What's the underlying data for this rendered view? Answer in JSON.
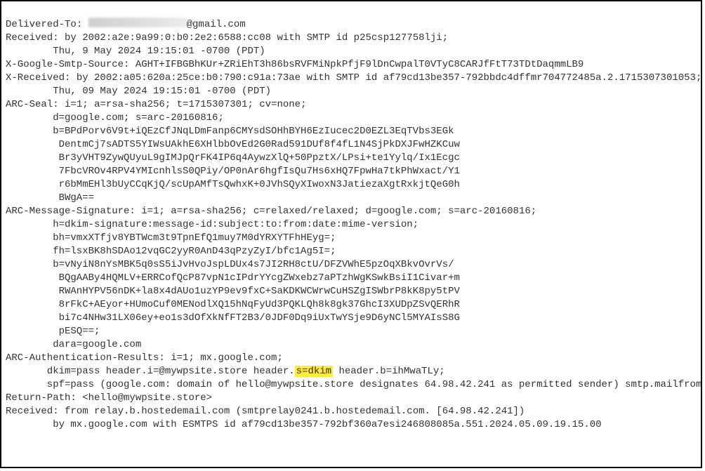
{
  "lines": {
    "l01a": "Delivered-To: ",
    "l01b": "@gmail.com",
    "l02": "Received: by 2002:a2e:9a99:0:b0:2e2:6588:cc08 with SMTP id p25csp127758lji;",
    "l03": "Thu, 9 May 2024 19:15:01 -0700 (PDT)",
    "l04": "X-Google-Smtp-Source: AGHT+IFBGBhKUr+ZRiEhT3h86bsRVFMiNpkPfjF9lDnCwpalT0VTyC8CARJfFtT73TDtDaqmmLB9",
    "l05": "X-Received: by 2002:a05:620a:25ce:b0:790:c91a:73ae with SMTP id af79cd13be357-792bbdc4dffmr704772485a.2.1715307301053;",
    "l06": "Thu, 09 May 2024 19:15:01 -0700 (PDT)",
    "l07": "ARC-Seal: i=1; a=rsa-sha256; t=1715307301; cv=none;",
    "l08": "d=google.com; s=arc-20160816;",
    "l09": "b=BPdPorv6V9t+iQEzCfJNqLDmFanp6CMYsdSOHhBYH6EzIucec2D0EZL3EqTVbs3EGk",
    "l10": " DentmCj7sADTS5YIWsUAkhE6XHlbbOvEd2G0Rad591DUf8f4fL1N4SjPkDXJFwHZKCuw",
    "l11": " Br3yVHT9ZywQUyuL9gIMJpQrFK4IP6q4AywzXlQ+50PpztX/LPsi+te1Yylq/Ix1Ecgc",
    "l12": " 7FbcVROv4RPV4YMIcnhlsS0QPiy/OP0nAr6hgfIsQu7Hs6xHQ7FpwHa7tkPhWxact/Y1",
    "l13": " r6bMmEHl3bUyCCqKjQ/scUpAMfTsQwhxK+0JVhSQyXIwoxN3JatiezaXgtRxkjtQeG0h",
    "l14": " BWgA==",
    "l15": "ARC-Message-Signature: i=1; a=rsa-sha256; c=relaxed/relaxed; d=google.com; s=arc-20160816;",
    "l16": "h=dkim-signature:message-id:subject:to:from:date:mime-version;",
    "l17": "bh=vmxXTfjv8YBTWcm3t9TpnEfQ1muy7M0dYRXYTFhHEyg=;",
    "l18": "fh=lsxBK8hSDAo12vqGC2yyR0AnD43qPzyZyI/bfc1Ag5I=;",
    "l19": "b=vNyiN8nYsMBK5q0sS5iJvHvoJspLDUx4s7JI2RH8ctU/DFZVWhE5pzOqXBkvOvrVs/",
    "l20": " BQgAABy4HQMLV+ERRCofQcP87vpN1cIPdrYYcgZWxebz7aPTzhWgKSwkBsiI1Civar+m",
    "l21": " RWAnHYPV56nDK+la8x4dAUo1uzYP9ev9fxC+SaKDKWCWrwCuHSZgISWbrP8kK8py5tPV",
    "l22": " 8rFkC+AEyor+HUmoCuf0MENodlXQ15hNqFyUd3PQKLQh8k8gk37GhcI3XUDpZSvQERhR",
    "l23": " bi7c4NHw31LX06ey+eo1s3dOfXkNfFT2B3/0JDF0Dq9iUxTwYSje9D6yNCl5MYAIsS8G",
    "l24": " pESQ==;",
    "l25": "dara=google.com",
    "l26": "ARC-Authentication-Results: i=1; mx.google.com;",
    "l27a": "dkim=pass header.i=@mywpsite.store header.",
    "l27hl": "s=dkim",
    "l27b": " header.b=ihMwaTLy;",
    "l28": "spf=pass (google.com: domain of hello@mywpsite.store designates 64.98.42.241 as permitted sender) smtp.mailfrom=hello@mywpsite.store",
    "l29": "Return-Path: <hello@mywpsite.store>",
    "l30": "Received: from relay.b.hostedemail.com (smtprelay0241.b.hostedemail.com. [64.98.42.241])",
    "l31": "by mx.google.com with ESMTPS id af79cd13be357-792bf360a7esi246808085a.551.2024.05.09.19.15.00"
  }
}
